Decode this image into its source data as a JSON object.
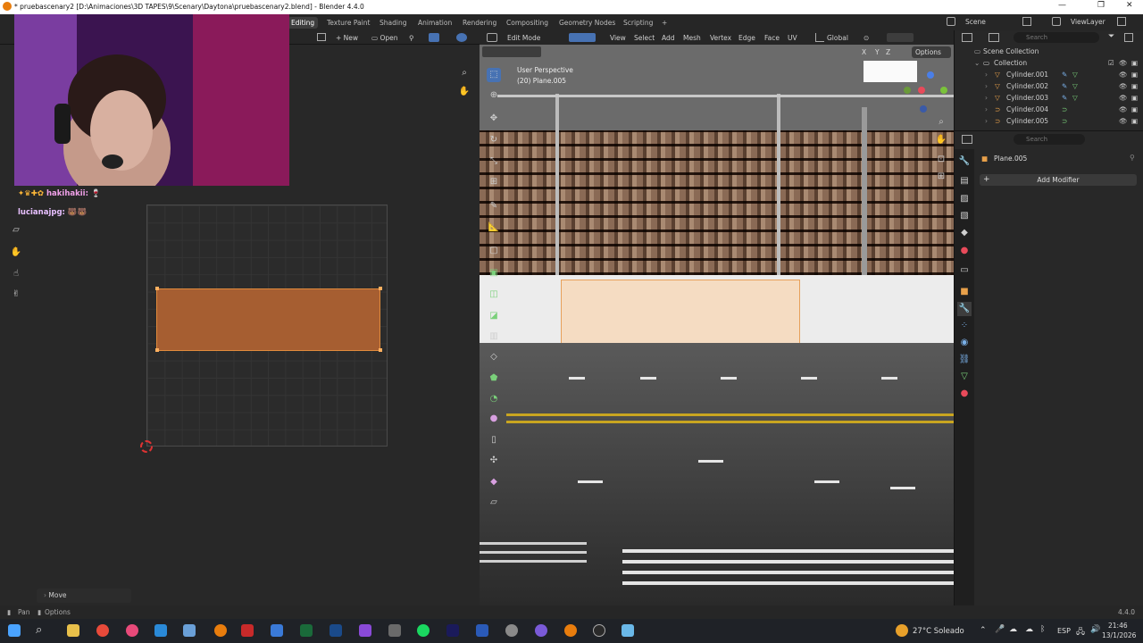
{
  "window": {
    "title": "* pruebascenary2 [D:\\Animaciones\\3D TAPES\\9\\Scenary\\Daytona\\pruebascenary2.blend] - Blender 4.4.0",
    "min_glyph": "—",
    "max_glyph": "❐",
    "close_glyph": "✕"
  },
  "workspaces": [
    "Editing",
    "Texture Paint",
    "Shading",
    "Animation",
    "Rendering",
    "Compositing",
    "Geometry Nodes",
    "Scripting",
    "+"
  ],
  "active_workspace": "Editing",
  "scene": {
    "scene_label": "Scene",
    "view_layer_label": "ViewLayer"
  },
  "uv_editor": {
    "new_label": "New",
    "open_label": "Open",
    "last_op": "Move"
  },
  "stream": {
    "chat": [
      {
        "user": "hakihakii:",
        "msg": "🍷"
      },
      {
        "user": "lucianajpg:",
        "msg": "🐻🐻"
      }
    ]
  },
  "viewport": {
    "mode": "Edit Mode",
    "menu": [
      "View",
      "Select",
      "Add",
      "Mesh",
      "Vertex",
      "Edge",
      "Face",
      "UV"
    ],
    "orientation": "Global",
    "perspective": "User Perspective",
    "object_info": "(20) Plane.005",
    "options_label": "Options",
    "axes": [
      "X",
      "Y",
      "Z"
    ]
  },
  "outliner": {
    "search_placeholder": "Search",
    "root": "Scene Collection",
    "collection": "Collection",
    "items": [
      "Cylinder.001",
      "Cylinder.002",
      "Cylinder.003",
      "Cylinder.004",
      "Cylinder.005"
    ]
  },
  "properties": {
    "search_placeholder": "Search",
    "object_name": "Plane.005",
    "add_modifier_label": "Add Modifier"
  },
  "status": {
    "left_pan": "Pan",
    "left_options": "Options",
    "version": "4.4.0"
  },
  "taskbar": {
    "weather": "27°C  Soleado",
    "lang": "ESP",
    "time": "21:46",
    "date": "13/1/2026"
  },
  "colors": {
    "accent_orange": "#e08a3c",
    "active_blue": "#4772b3"
  }
}
